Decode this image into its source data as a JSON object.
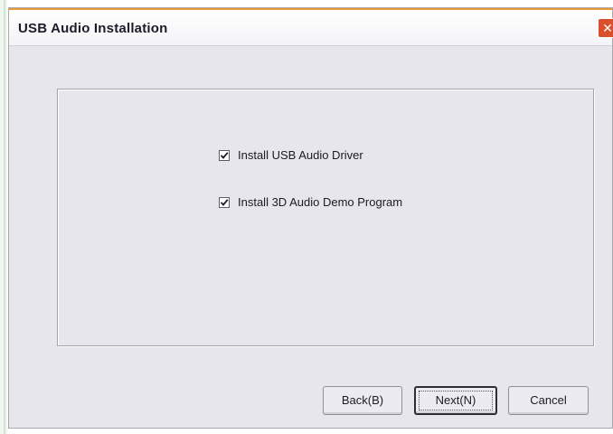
{
  "window": {
    "title": "USB Audio Installation",
    "close_label": "✕"
  },
  "options": [
    {
      "label": "Install USB Audio Driver",
      "checked": true
    },
    {
      "label": "Install 3D Audio Demo Program",
      "checked": true
    }
  ],
  "buttons": {
    "back_label": "Back(B)",
    "next_label": "Next(N)",
    "cancel_label": "Cancel"
  },
  "icons": {
    "close": "close-icon",
    "check": "checkmark-icon"
  },
  "colors": {
    "title_accent": "#e79c3c",
    "close_button": "#d9512c",
    "dialog_background": "#e7e6ec"
  }
}
